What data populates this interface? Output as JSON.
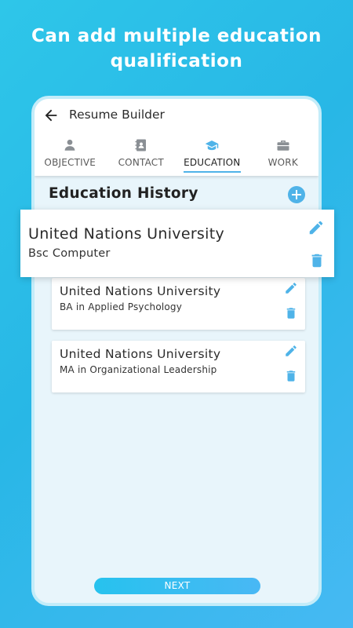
{
  "headline": {
    "line1": "Can add multiple education",
    "line2": "qualification"
  },
  "appbar": {
    "back_icon": "arrow-left-icon",
    "title": "Resume Builder"
  },
  "tabs": [
    {
      "label": "OBJECTIVE",
      "icon": "person-icon",
      "active": false
    },
    {
      "label": "CONTACT",
      "icon": "contact-book-icon",
      "active": false
    },
    {
      "label": "EDUCATION",
      "icon": "graduation-cap-icon",
      "active": true
    },
    {
      "label": "WORK",
      "icon": "briefcase-icon",
      "active": false
    }
  ],
  "section": {
    "title": "Education History",
    "add_icon": "add-circle-icon"
  },
  "entries": [
    {
      "university": "United Nations University",
      "degree": "Bsc Computer"
    },
    {
      "university": "United Nations University",
      "degree": "BA in Applied Psychology"
    },
    {
      "university": "United Nations University",
      "degree": "MA in Organizational Leadership"
    }
  ],
  "actions": {
    "next_label": "NEXT"
  },
  "colors": {
    "background": "#2ec6e9",
    "accent": "#4fb3e8",
    "icon_gray": "#8a8f94",
    "screen_bg": "#e8f5fb"
  }
}
